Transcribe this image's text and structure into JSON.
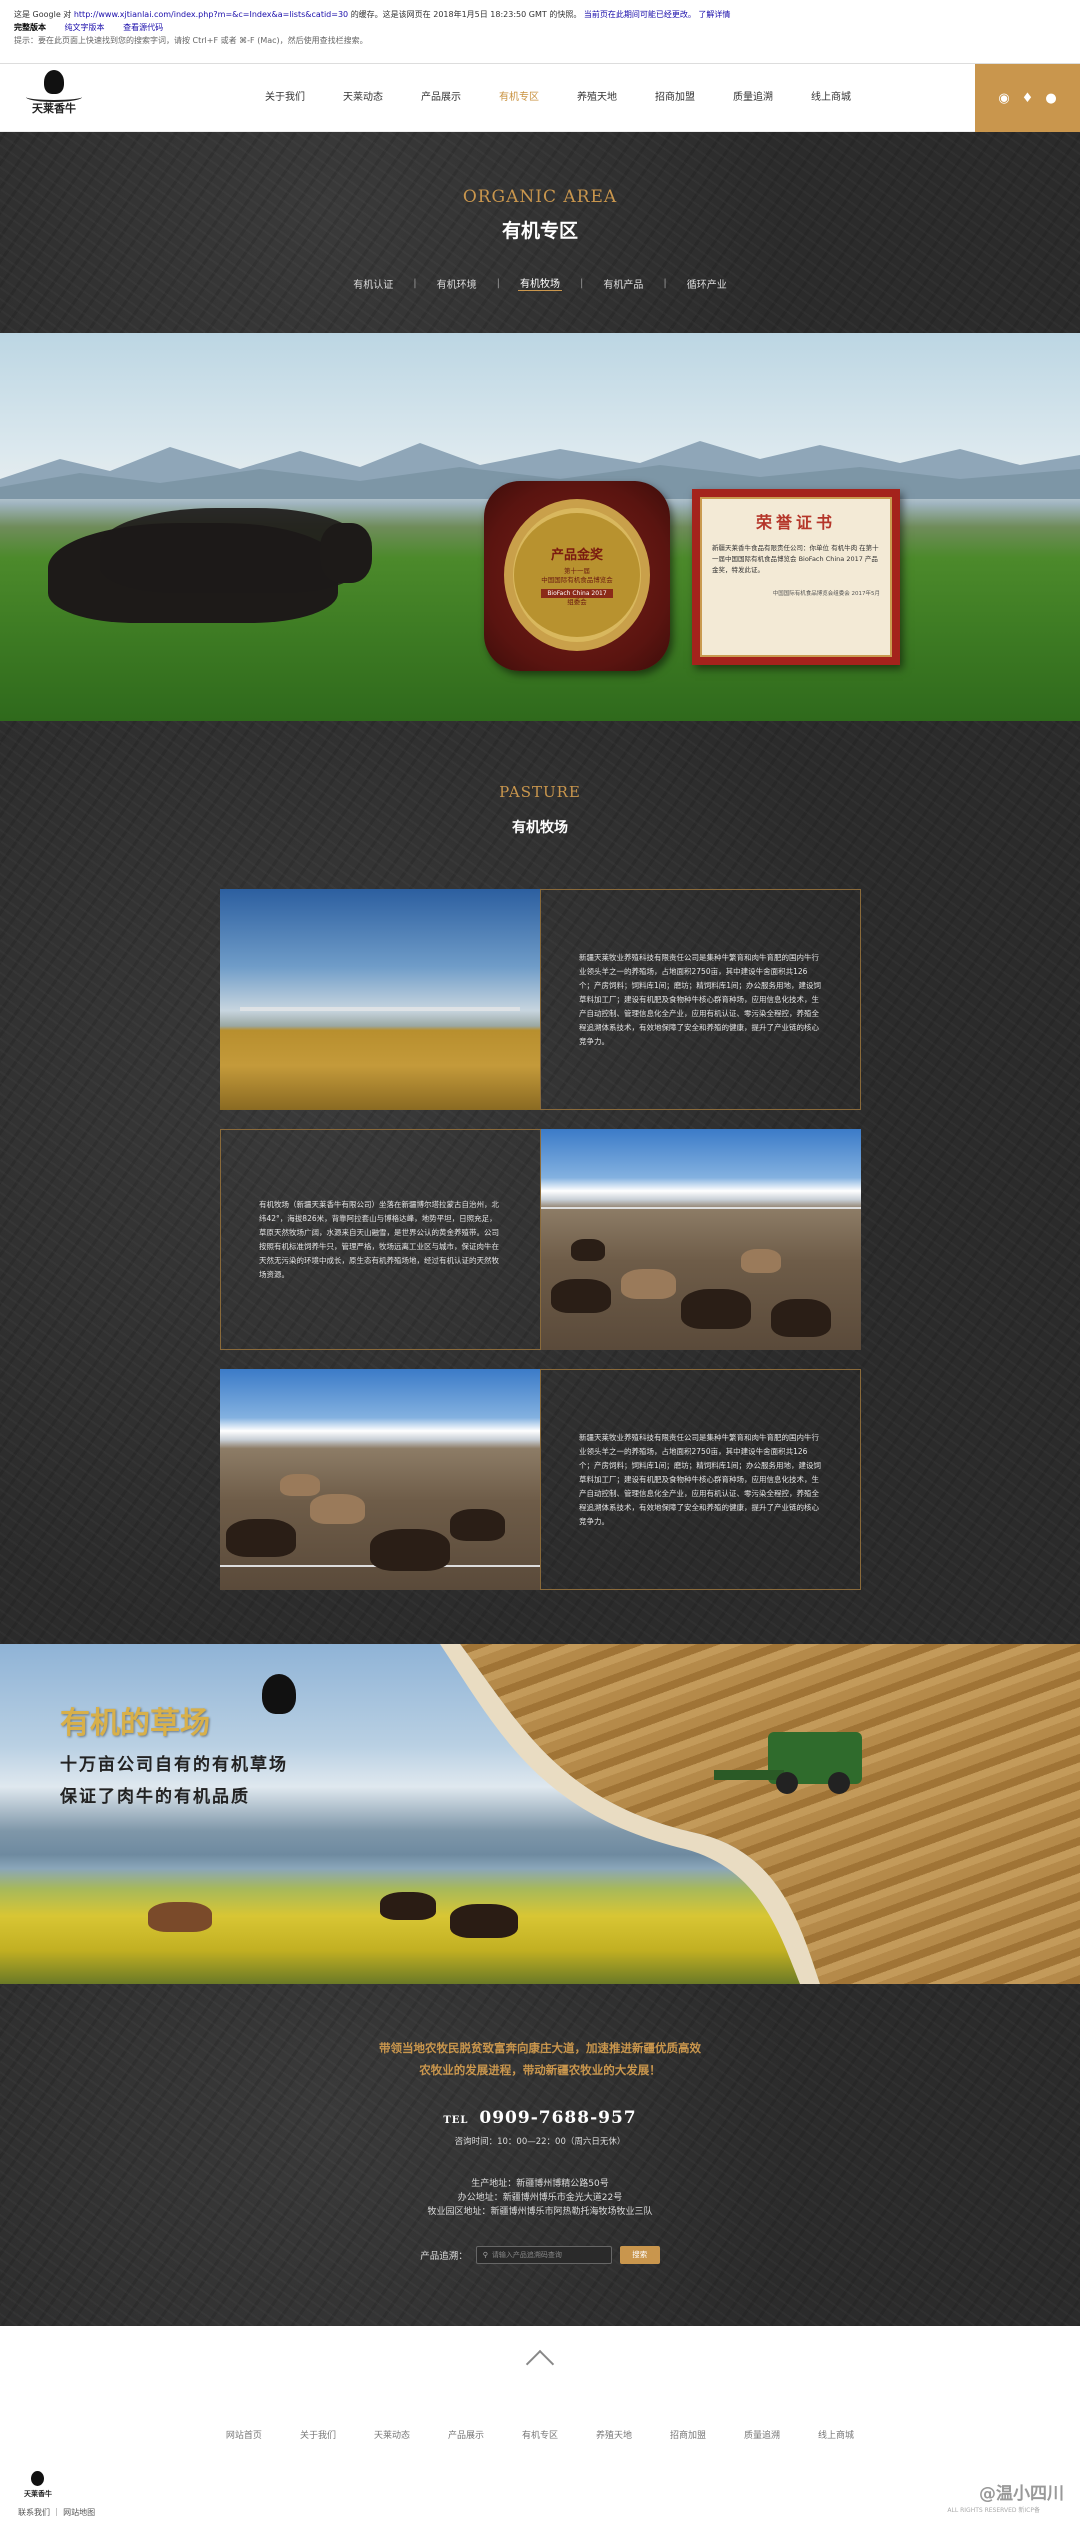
{
  "cache_bar": {
    "line1_prefix": "这是 Google 对",
    "line1_url": "http://www.xjtianlai.com/index.php?m=&c=Index&a=lists&catid=30",
    "line1_suffix": "的缓存。这是该网页在 2018年1月5日 18:23:50 GMT 的快照。",
    "line1_note": "当前页在此期间可能已经更改。",
    "line1_link": "了解详情",
    "label_full": "完整版本",
    "link_text_only": "纯文字版本",
    "link_view_source": "查看源代码",
    "tip": "提示：要在此页面上快速找到您的搜索字词，请按 Ctrl+F 或者 ⌘-F (Mac)，然后使用查找栏搜索。"
  },
  "header": {
    "logo_text": "天莱香牛",
    "nav": [
      "关于我们",
      "天莱动态",
      "产品展示",
      "有机专区",
      "养殖天地",
      "招商加盟",
      "质量追溯",
      "线上商城"
    ],
    "active_index": 3,
    "social_icons": [
      "weibo-icon",
      "bell-icon",
      "wechat-icon"
    ]
  },
  "section_banner": {
    "en_title": "ORGANIC AREA",
    "cn_title": "有机专区",
    "subnav": [
      "有机认证",
      "有机环境",
      "有机牧场",
      "有机产品",
      "循环产业"
    ],
    "active_index": 2
  },
  "hero": {
    "plaque_title": "产品金奖",
    "plaque_line1": "第十一届",
    "plaque_line2": "中国国际有机食品博览会",
    "plaque_strip": "BioFach China 2017",
    "plaque_org": "组委会",
    "cert_title": "荣誉证书",
    "cert_body": "新疆天莱香牛食品有限责任公司：你单位 有机牛肉 在第十一届中国国际有机食品博览会 BioFach China 2017 产品金奖，特发此证。",
    "cert_sign": "中国国际有机食品博览会组委会 2017年5月"
  },
  "pasture": {
    "en_title": "PASTURE",
    "cn_title": "有机牧场",
    "cards": [
      {
        "image": "steppe-landscape",
        "text": "新疆天莱牧业养殖科技有限责任公司是集种牛繁育和肉牛育肥的国内牛行业领头羊之一的养殖场，占地面积2750亩，其中建设牛舍面积共126个；产房饲料；饲料库1间；磨坊；精饲料库1间；办公服务用地，建设饲草料加工厂；建设有机肥及食物种牛核心群育种场，应用信息化技术，生产自动控制、管理信息化全产业，应用有机认证、零污染全程控，养殖全程追溯体系技术，有效地保障了安全和养殖的健康，提升了产业链的核心竞争力。"
      },
      {
        "image": "feedlot-mountains",
        "text": "有机牧场（新疆天莱香牛有限公司）坐落在新疆博尔塔拉蒙古自治州，北纬42°，海拔826米，背靠阿拉套山与博格达峰，地势平坦，日照充足，草原天然牧场广阔，水源来自天山融雪，是世界公认的黄金养殖带。公司按照有机标准饲养牛只，管理严格，牧场远离工业区与城市，保证肉牛在天然无污染的环境中成长，原生态有机养殖场地，经过有机认证的天然牧场资源。"
      },
      {
        "image": "feedlot-herd",
        "text": "新疆天莱牧业养殖科技有限责任公司是集种牛繁育和肉牛育肥的国内牛行业领头羊之一的养殖场，占地面积2750亩，其中建设牛舍面积共126个；产房饲料；饲料库1间；磨坊；精饲料库1间；办公服务用地，建设饲草料加工厂；建设有机肥及食物种牛核心群育种场，应用信息化技术，生产自动控制、管理信息化全产业，应用有机认证、零污染全程控，养殖全程追溯体系技术，有效地保障了安全和养殖的健康，提升了产业链的核心竞争力。"
      }
    ]
  },
  "promo": {
    "title": "有机的草场",
    "line1": "十万亩公司自有的有机草场",
    "line2": "保证了肉牛的有机品质"
  },
  "contact": {
    "slogan1": "带领当地农牧民脱贫致富奔向康庄大道，加速推进新疆优质高效",
    "slogan2": "农牧业的发展进程，带动新疆农牧业的大发展！",
    "tel_label": "TEL",
    "tel": "0909-7688-957",
    "hours": "咨询时间：10：00—22：00（周六日无休）",
    "address1": "生产地址：新疆博州博精公路50号",
    "address2": "办公地址：新疆博州博乐市金光大道22号",
    "address3": "牧业园区地址：新疆博州博乐市阿热勒托海牧场牧业三队",
    "trace_label": "产品追溯：",
    "trace_placeholder": "请输入产品追溯码查询",
    "trace_button": "搜索"
  },
  "bottom_nav": [
    "网站首页",
    "关于我们",
    "天莱动态",
    "产品展示",
    "有机专区",
    "养殖天地",
    "招商加盟",
    "质量追溯",
    "线上商城"
  ],
  "footer": {
    "logo_text": "天莱香牛",
    "links": "联系我们 ｜ 网站地图",
    "watermark": "@温小四川",
    "copyright": "ALL RIGHTS RESERVED 新ICP备"
  }
}
